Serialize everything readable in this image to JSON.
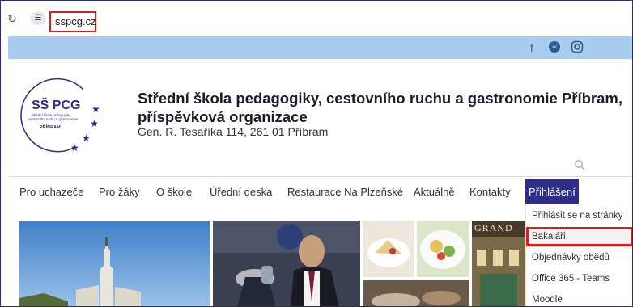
{
  "browser": {
    "url": "sspcg.cz"
  },
  "social": {
    "icons": [
      "facebook-icon",
      "messenger-icon",
      "instagram-icon"
    ]
  },
  "header": {
    "logo_text": "SŠ PCG",
    "logo_sub1": "Střední škola pedagogiky,",
    "logo_sub2": "cestovního ruchu a gastronomie",
    "logo_city": "PŘÍBRAM",
    "title_line1": "Střední škola pedagogiky, cestovního ruchu a gastronomie Příbram,",
    "title_line2": "příspěvková organizace",
    "address": "Gen. R. Tesaříka 114, 261 01 Příbram"
  },
  "nav": {
    "items": [
      "Pro uchazeče",
      "Pro žáky",
      "O škole",
      "Úřední deska",
      "Restaurace Na Plzeňské",
      "Aktuálně",
      "Kontakty",
      "Přihlášení"
    ]
  },
  "dropdown": {
    "items": [
      "Přihlásit se na stránky",
      "Bakaláři",
      "Objednávky obědů",
      "Office 365 - Teams",
      "Moodle"
    ]
  },
  "photos": {
    "sign_text": "GRAND"
  },
  "colors": {
    "nav_active": "#2e2e88",
    "social_bar": "#a9cdf1",
    "highlight": "#e01b1b"
  }
}
